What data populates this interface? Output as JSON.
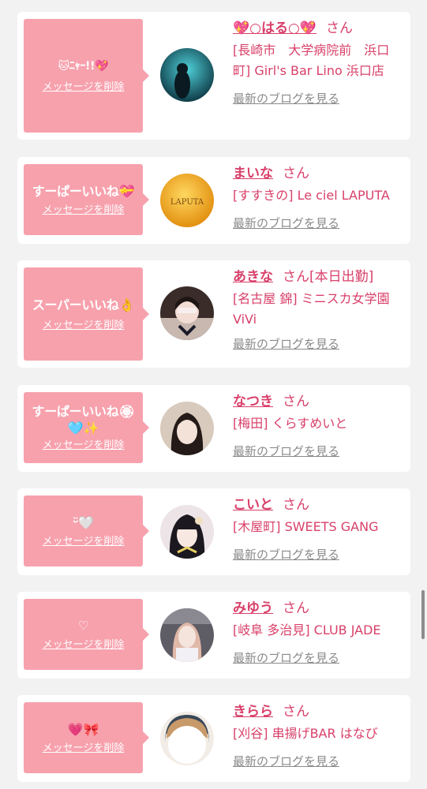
{
  "items": [
    {
      "message": "🐱ﾆｬｰ!!💖",
      "delete_label": "メッセージを削除",
      "name": "💖○はる○💖",
      "honorific": "さん",
      "shop": "[長崎市　大学病院前　浜口町] Girl's Bar Lino 浜口店",
      "blog_label": "最新のブログを見る",
      "avatar_colors": [
        "#1a5a6a",
        "#2bb0b8"
      ]
    },
    {
      "message": "すーぱーいいね💝",
      "delete_label": "メッセージを削除",
      "name": "まいな",
      "honorific": "さん",
      "shop": "[すすきの] Le ciel LAPUTA",
      "blog_label": "最新のブログを見る",
      "avatar_colors": [
        "#f5c12a",
        "#e89a10"
      ],
      "avatar_text": "LAPUTA"
    },
    {
      "message": "スーパーいいね👌",
      "delete_label": "メッセージを削除",
      "name": "あきな",
      "honorific": "さん",
      "honorific_extra": "[本日出勤]",
      "shop": "[名古屋 錦] ミニスカ女学園ViVi",
      "blog_label": "最新のブログを見る",
      "avatar_colors": [
        "#3a2a2a",
        "#d8c8c0"
      ]
    },
    {
      "message": "すーぱーいいね🏵🩵✨",
      "delete_label": "メッセージを削除",
      "name": "なつき",
      "honorific": "さん",
      "shop": "[梅田] くらすめいと",
      "blog_label": "最新のブログを見る",
      "avatar_colors": [
        "#2a2020",
        "#e8d8c8"
      ]
    },
    {
      "message": "ᵕ̈🤍",
      "delete_label": "メッセージを削除",
      "name": "こいと",
      "honorific": "さん",
      "shop": "[木屋町] SWEETS GANG",
      "blog_label": "最新のブログを見る",
      "avatar_colors": [
        "#1e1a22",
        "#f4ece8"
      ]
    },
    {
      "message": "♡",
      "delete_label": "メッセージを削除",
      "name": "みゆう",
      "honorific": "さん",
      "shop": "[岐阜 多治見] CLUB JADE",
      "blog_label": "最新のブログを見る",
      "avatar_colors": [
        "#6a6870",
        "#e8e4ea"
      ]
    },
    {
      "message": "💗🎀",
      "delete_label": "メッセージを削除",
      "name": "きらら",
      "honorific": "さん",
      "shop": "[刈谷] 串揚げBAR はなび",
      "blog_label": "最新のブログを見る",
      "avatar_colors": [
        "#3a4a5a",
        "#ffffff"
      ]
    }
  ]
}
